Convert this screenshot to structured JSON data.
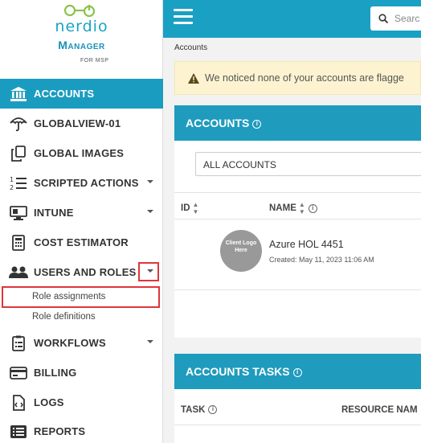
{
  "brand": {
    "name": "nerdio",
    "product": "Manager",
    "edition": "FOR MSP",
    "colors": {
      "primary": "#1aa0c3",
      "header": "#1f9bbe",
      "callout": "#e0353b"
    }
  },
  "sidebar": {
    "items": [
      {
        "label": "ACCOUNTS",
        "icon": "bank-icon",
        "active": true
      },
      {
        "label": "GLOBALVIEW-01",
        "icon": "umbrella-icon"
      },
      {
        "label": "GLOBAL IMAGES",
        "icon": "copy-icon"
      },
      {
        "label": "SCRIPTED ACTIONS",
        "icon": "numbered-list-icon",
        "caret": true
      },
      {
        "label": "INTUNE",
        "icon": "monitor-icon",
        "caret": true
      },
      {
        "label": "COST ESTIMATOR",
        "icon": "calculator-icon"
      },
      {
        "label": "USERS AND ROLES",
        "icon": "users-icon",
        "caret": true
      },
      {
        "label": "WORKFLOWS",
        "icon": "clipboard-icon",
        "caret": true
      },
      {
        "label": "BILLING",
        "icon": "credit-card-icon"
      },
      {
        "label": "LOGS",
        "icon": "file-code-icon"
      },
      {
        "label": "REPORTS",
        "icon": "list-icon"
      }
    ],
    "sub_items": [
      "Role assignments",
      "Role definitions"
    ]
  },
  "callouts": [
    "1",
    "2"
  ],
  "topbar": {
    "search_placeholder": "Searc"
  },
  "breadcrumb": "Accounts",
  "warning": "We noticed none of your accounts are flagge",
  "accounts_card": {
    "title": "ACCOUNTS",
    "filter": "ALL ACCOUNTS",
    "columns": [
      "ID",
      "NAME"
    ],
    "rows": [
      {
        "avatar": "Client Logo Here",
        "name": "Azure HOL 4451",
        "created": "Created: May 11, 2023 11:06 AM"
      }
    ]
  },
  "tasks_card": {
    "title": "ACCOUNTS TASKS",
    "columns": [
      "TASK",
      "RESOURCE NAM"
    ]
  }
}
